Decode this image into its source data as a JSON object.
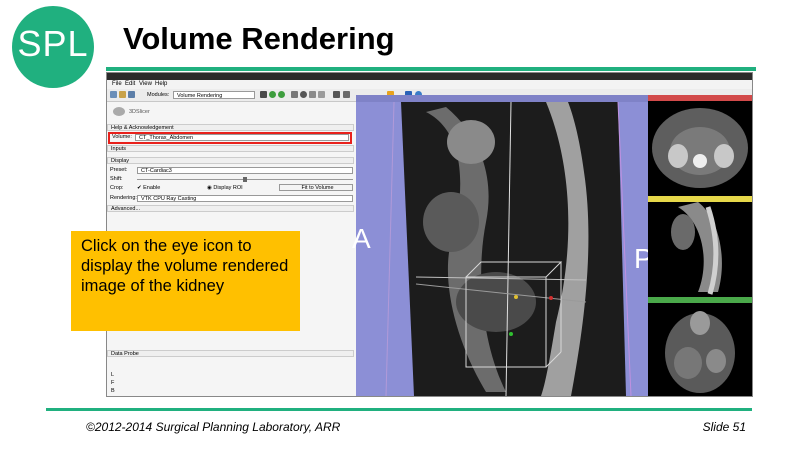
{
  "slide": {
    "logo_text": "SPL",
    "title": "Volume Rendering",
    "footer_left": "©2012-2014 Surgical Planning Laboratory, ARR",
    "footer_right": "Slide 51",
    "accent_color": "#20b07f",
    "callout_text": "Click on the eye icon to display the volume rendered image of the kidney",
    "callout_color": "#ffc000"
  },
  "app": {
    "menu": [
      "File",
      "Edit",
      "View",
      "Help"
    ],
    "modules_label": "Modules:",
    "module_selected": "Volume Rendering",
    "module_logo_text": "3DSlicer",
    "sections": {
      "help": "Help & Acknowledgement",
      "inputs": "Inputs",
      "display": "Display",
      "advanced": "Advanced...",
      "data_probe": "Data Probe"
    },
    "volume_label": "Volume:",
    "volume_value": "CT_Thorax_Abdomen",
    "preset_label": "Preset:",
    "preset_value": "CT-Cardiac3",
    "shift_label": "Shift:",
    "crop_label": "Crop:",
    "crop_enable": "Enable",
    "display_roi": "Display ROI",
    "fit_to_volume": "Fit to Volume",
    "rendering_label": "Rendering:",
    "rendering_value": "VTK CPU Ray Casting",
    "orientation_letters": [
      "L",
      "F",
      "B"
    ],
    "view_letters": {
      "left": "A",
      "right": "P"
    },
    "highlight_color": "#e8211c",
    "view_background": "#8c8fd6"
  }
}
